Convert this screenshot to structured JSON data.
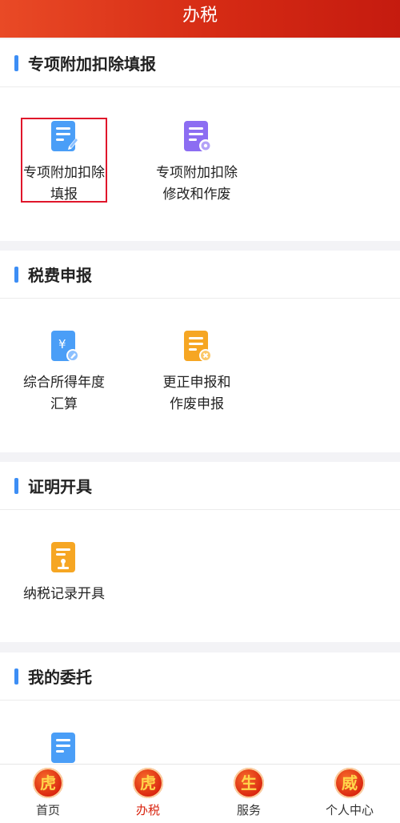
{
  "header": {
    "title": "办税"
  },
  "sections": [
    {
      "title": "专项附加扣除填报",
      "items": [
        {
          "label": "专项附加扣除\n填报",
          "icon": "document-edit-icon"
        },
        {
          "label": "专项附加扣除\n修改和作废",
          "icon": "document-settings-icon"
        }
      ]
    },
    {
      "title": "税费申报",
      "items": [
        {
          "label": "综合所得年度\n汇算",
          "icon": "yuan-document-icon"
        },
        {
          "label": "更正申报和\n作废申报",
          "icon": "document-cancel-icon"
        }
      ]
    },
    {
      "title": "证明开具",
      "items": [
        {
          "label": "纳税记录开具",
          "icon": "certificate-stamp-icon"
        }
      ]
    },
    {
      "title": "我的委托",
      "items": [
        {
          "icon": "document-icon"
        }
      ]
    }
  ],
  "tabs": [
    {
      "label": "首页",
      "glyph": "虎",
      "active": false
    },
    {
      "label": "办税",
      "glyph": "虎",
      "active": true
    },
    {
      "label": "服务",
      "glyph": "生",
      "active": false
    },
    {
      "label": "个人中心",
      "glyph": "威",
      "active": false
    }
  ],
  "colors": {
    "header_start": "#e94a26",
    "header_end": "#c51b0f",
    "section_accent": "#3d8ef5",
    "highlight_border": "#e0162b"
  }
}
